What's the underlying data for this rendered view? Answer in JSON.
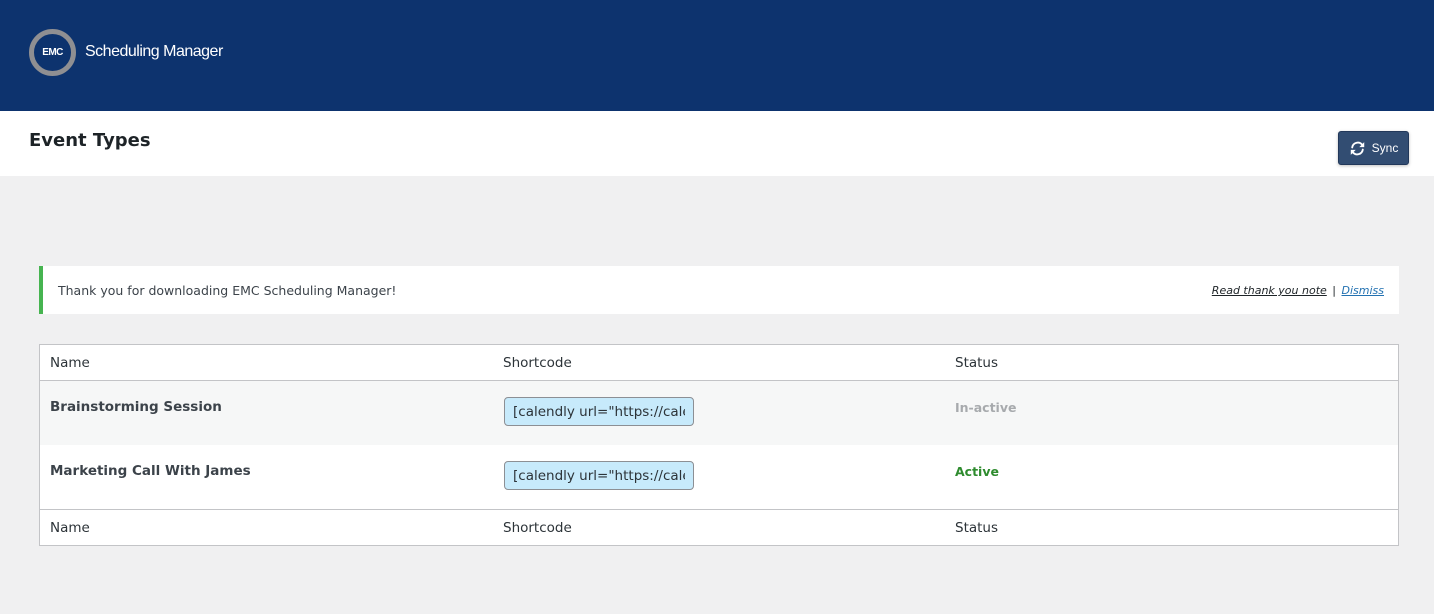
{
  "brand": {
    "logo_text": "EMC",
    "name": "Scheduling Manager",
    "bar_color": "#0d336e"
  },
  "page": {
    "title": "Event Types",
    "sync_label": "Sync",
    "sync_icon": "refresh-icon"
  },
  "notice": {
    "message": "Thank you for downloading EMC Scheduling Manager!",
    "read_link": "Read thank you note",
    "separator": "|",
    "dismiss_link": "Dismiss",
    "accent_color": "#46b450"
  },
  "table": {
    "columns": [
      "Name",
      "Shortcode",
      "Status"
    ],
    "rows": [
      {
        "name": "Brainstorming Session",
        "shortcode": "[calendly url=\"https://calendly.com",
        "status": "In-active"
      },
      {
        "name": "Marketing Call With James",
        "shortcode": "[calendly url=\"https://calendly.com",
        "status": "Active"
      }
    ],
    "status_colors": {
      "inactive": "#a7aaad",
      "active": "#2e8b2e"
    }
  }
}
